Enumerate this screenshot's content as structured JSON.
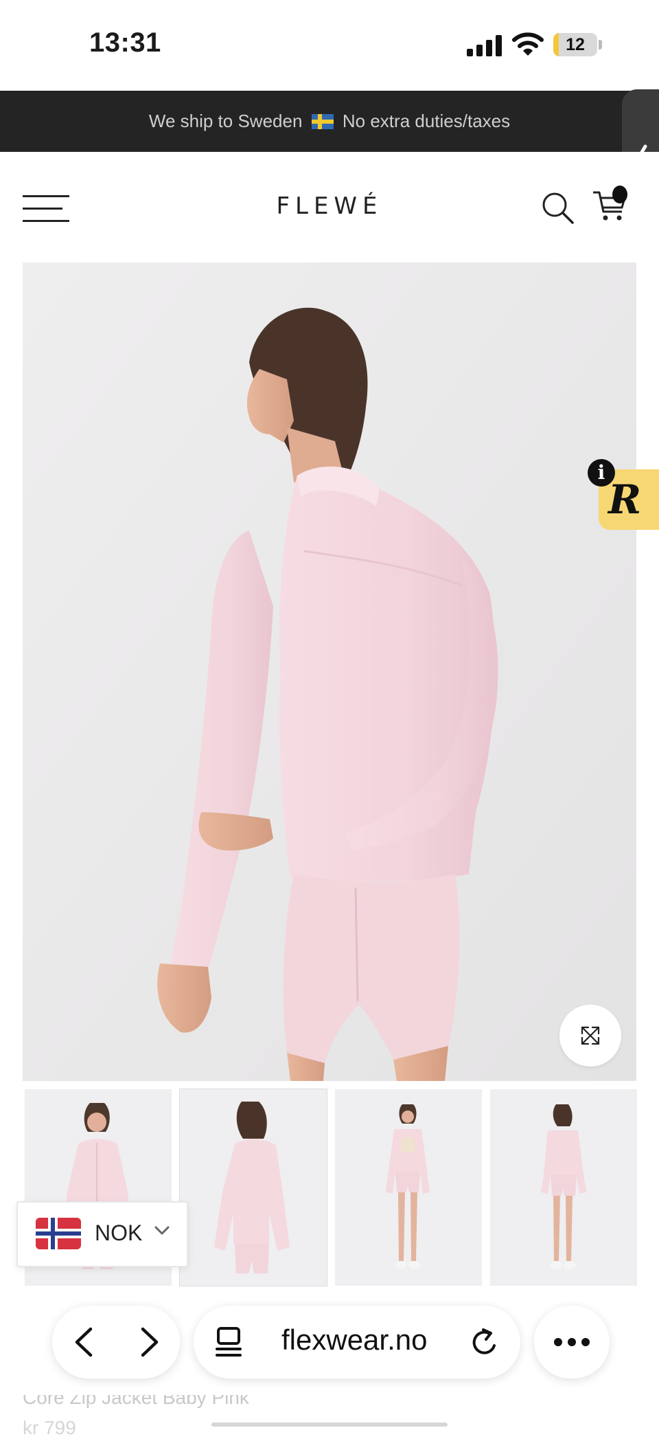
{
  "status_bar": {
    "time": "13:31",
    "battery": "12",
    "battery_level": 0.12
  },
  "announcement": {
    "text_before": "We ship to Sweden",
    "text_after": "No extra duties/taxes"
  },
  "header": {
    "logo": "FLEWÉ",
    "cart_count": "0"
  },
  "gallery": {
    "thumbnails": [
      "front-view",
      "back-view",
      "full-front-view",
      "full-back-view"
    ],
    "selected_index": 1
  },
  "currency": {
    "code": "NOK"
  },
  "browser": {
    "url": "flexwear.no"
  },
  "product": {
    "title": "Core Zip Jacket Baby Pink",
    "price": "kr 799"
  },
  "colors": {
    "accent_badge": "#f7d774",
    "announce_bg": "#242424",
    "product_pink": "#f4d7de"
  }
}
